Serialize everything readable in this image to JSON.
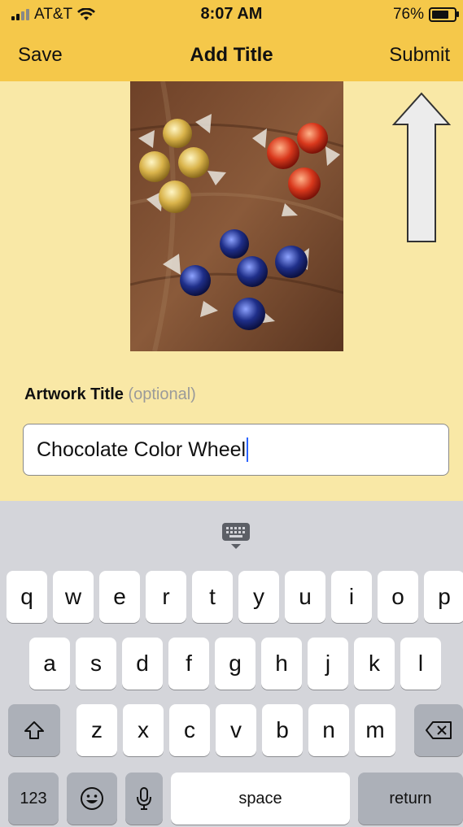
{
  "status_bar": {
    "carrier": "AT&T",
    "time": "8:07 AM",
    "battery": "76%",
    "battery_level": 0.76
  },
  "nav": {
    "left_button": "Save",
    "title": "Add Title",
    "right_button": "Submit"
  },
  "form": {
    "label": "Artwork Title",
    "label_hint": "(optional)",
    "title_value": "Chocolate Color Wheel"
  },
  "keyboard": {
    "row1": [
      "q",
      "w",
      "e",
      "r",
      "t",
      "y",
      "u",
      "i",
      "o",
      "p"
    ],
    "row2": [
      "a",
      "s",
      "d",
      "f",
      "g",
      "h",
      "j",
      "k",
      "l"
    ],
    "row3": [
      "z",
      "x",
      "c",
      "v",
      "b",
      "n",
      "m"
    ],
    "numbers_key": "123",
    "space_key": "space",
    "return_key": "return"
  },
  "colors": {
    "header": "#f5c84a",
    "background": "#f9e8a6",
    "caret": "#2b63ff"
  }
}
